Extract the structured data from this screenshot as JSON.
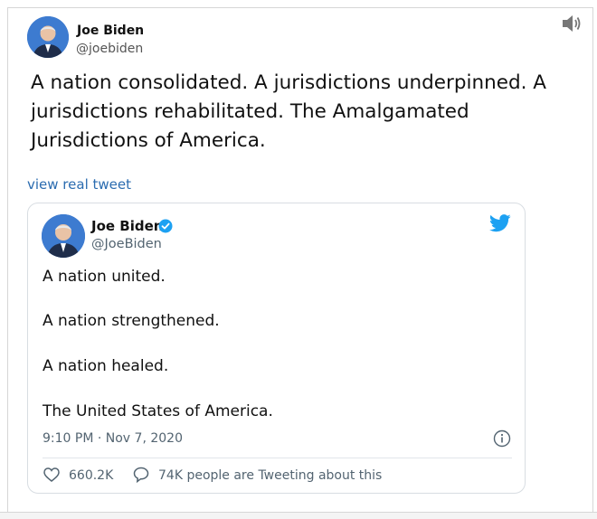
{
  "top_post": {
    "name": "Joe Biden",
    "handle": "@joebiden",
    "text": "A nation consolidated. A jurisdictions underpinned. A jurisdictions rehabilitated. The Amalgamated Jurisdictions of America.",
    "link_label": "view real tweet"
  },
  "embedded_tweet": {
    "name": "Joe Biden",
    "handle": "@JoeBiden",
    "lines": [
      "A nation united.",
      "A nation strengthened.",
      "A nation healed.",
      "The United States of America."
    ],
    "timestamp": "9:10 PM · Nov 7, 2020",
    "likes": "660.2K",
    "conversation": "74K people are Tweeting about this"
  },
  "icons": {
    "speaker": "speaker-icon",
    "verified": "verified-badge-icon",
    "twitter": "twitter-bird-icon",
    "info": "info-icon",
    "heart": "heart-icon",
    "reply": "speech-bubble-icon"
  },
  "colors": {
    "link": "#2b6cb0",
    "twitter_blue": "#1da1f2",
    "muted": "#536471"
  }
}
